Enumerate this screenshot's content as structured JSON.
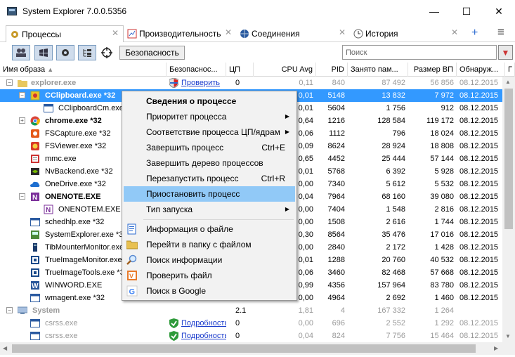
{
  "window": {
    "title": "System Explorer 7.0.0.5356",
    "min": "—",
    "max": "☐",
    "close": "✕"
  },
  "tabs": [
    {
      "label": "Процессы",
      "icon": "gear-icon",
      "active": true
    },
    {
      "label": "Производительность",
      "icon": "chart-icon"
    },
    {
      "label": "Соединения",
      "icon": "globe-icon"
    },
    {
      "label": "История",
      "icon": "clock-icon"
    }
  ],
  "tab_add": "+",
  "tab_menu": "≡",
  "toolbar": {
    "security_label": "Безопасность",
    "search_placeholder": "Поиск"
  },
  "columns": [
    "Имя образа",
    "Безопаснос...",
    "ЦП",
    "CPU Avg",
    "PID",
    "Занято пам...",
    "Размер ВП",
    "Обнаруж...",
    "Г"
  ],
  "rows": [
    {
      "name": "explorer.exe",
      "group": true,
      "security": "Проверить",
      "cpu": "0",
      "cpuavg": "0,11",
      "pid": "840",
      "mem": "87 492",
      "vm": "56 856",
      "date": "08.12.2015"
    },
    {
      "name": "CClipboard.exe *32",
      "selected": true,
      "cpuavg": "0,01",
      "pid": "5148",
      "mem": "13 832",
      "vm": "7 972",
      "date": "08.12.2015"
    },
    {
      "name": "CClipboardCm.exe",
      "cpuavg": "0,01",
      "pid": "5604",
      "mem": "1 756",
      "vm": "912",
      "date": "08.12.2015"
    },
    {
      "name": "chrome.exe *32",
      "bold": true,
      "cpuavg": "0,64",
      "pid": "1216",
      "mem": "128 584",
      "vm": "119 172",
      "date": "08.12.2015"
    },
    {
      "name": "FSCapture.exe *32",
      "cpuavg": "0,06",
      "pid": "1112",
      "mem": "796",
      "vm": "18 024",
      "date": "08.12.2015"
    },
    {
      "name": "FSViewer.exe *32",
      "cpuavg": "0,09",
      "pid": "8624",
      "mem": "28 924",
      "vm": "18 808",
      "date": "08.12.2015"
    },
    {
      "name": "mmc.exe",
      "cpuavg": "0,65",
      "pid": "4452",
      "mem": "25 444",
      "vm": "57 144",
      "date": "08.12.2015"
    },
    {
      "name": "NvBackend.exe *32",
      "cpuavg": "0,01",
      "pid": "5768",
      "mem": "6 392",
      "vm": "5 928",
      "date": "08.12.2015"
    },
    {
      "name": "OneDrive.exe *32",
      "cpuavg": "0,00",
      "pid": "7340",
      "mem": "5 612",
      "vm": "5 532",
      "date": "08.12.2015"
    },
    {
      "name": "ONENOTE.EXE",
      "bold": true,
      "cpuavg": "0,04",
      "pid": "7964",
      "mem": "68 160",
      "vm": "39 080",
      "date": "08.12.2015"
    },
    {
      "name": "ONENOTEM.EXE",
      "cpuavg": "0,00",
      "pid": "7404",
      "mem": "1 548",
      "vm": "2 816",
      "date": "08.12.2015"
    },
    {
      "name": "schedhlp.exe *32",
      "cpuavg": "0,00",
      "pid": "1508",
      "mem": "2 616",
      "vm": "1 744",
      "date": "08.12.2015"
    },
    {
      "name": "SystemExplorer.exe *32",
      "cpuavg": "0,30",
      "pid": "8564",
      "mem": "35 476",
      "vm": "17 016",
      "date": "08.12.2015"
    },
    {
      "name": "TibMounterMonitor.exe",
      "cpuavg": "0,00",
      "pid": "2840",
      "mem": "2 172",
      "vm": "1 428",
      "date": "08.12.2015"
    },
    {
      "name": "TrueImageMonitor.exe",
      "cpuavg": "0,01",
      "pid": "1288",
      "mem": "20 760",
      "vm": "40 532",
      "date": "08.12.2015"
    },
    {
      "name": "TrueImageTools.exe *32",
      "cpuavg": "0,06",
      "pid": "3460",
      "mem": "82 468",
      "vm": "57 668",
      "date": "08.12.2015"
    },
    {
      "name": "WINWORD.EXE",
      "cpuavg": "0,99",
      "pid": "4356",
      "mem": "157 964",
      "vm": "83 780",
      "date": "08.12.2015"
    },
    {
      "name": "wmagent.exe *32",
      "security": "",
      "cpuavg": "0,00",
      "pid": "4964",
      "mem": "2 692",
      "vm": "1 460",
      "date": "08.12.2015"
    },
    {
      "name": "System",
      "group": true,
      "cpu": "2.1",
      "cpuavg": "1,81",
      "pid": "4",
      "mem": "167 332",
      "vm": "1 264",
      "date": ""
    },
    {
      "name": "csrss.exe",
      "dim": true,
      "security": "Подробность",
      "cpu": "0",
      "cpuavg": "0,00",
      "pid": "696",
      "mem": "2 552",
      "vm": "1 292",
      "date": "08.12.2015"
    },
    {
      "name": "csrss.exe",
      "dim": true,
      "security": "Подробность",
      "cpu": "0",
      "cpuavg": "0,04",
      "pid": "824",
      "mem": "7 756",
      "vm": "15 464",
      "date": "08.12.2015"
    }
  ],
  "context_menu": [
    {
      "label": "Сведения о процессе",
      "bold": true
    },
    {
      "label": "Приоритет процесса",
      "submenu": true
    },
    {
      "label": "Соответствие процесса ЦП/ядрам",
      "submenu": true
    },
    {
      "label": "Завершить процесс",
      "shortcut": "Ctrl+E"
    },
    {
      "label": "Завершить дерево процессов"
    },
    {
      "label": "Перезапустить процесс",
      "shortcut": "Ctrl+R"
    },
    {
      "label": "Приостановить процесс",
      "highlighted": true
    },
    {
      "label": "Тип запуска",
      "submenu": true
    },
    {
      "label": "Информация о файле",
      "icon": "file-info-icon"
    },
    {
      "label": "Перейти в папку с файлом",
      "icon": "folder-icon"
    },
    {
      "label": "Поиск информации",
      "icon": "magnifier-icon"
    },
    {
      "label": "Проверить файл",
      "icon": "check-file-icon"
    },
    {
      "label": "Поиск в Google",
      "icon": "google-icon"
    }
  ],
  "colors": {
    "selection": "#3399ff",
    "menu_highlight": "#91c9f7",
    "link": "#1a3bcc"
  }
}
